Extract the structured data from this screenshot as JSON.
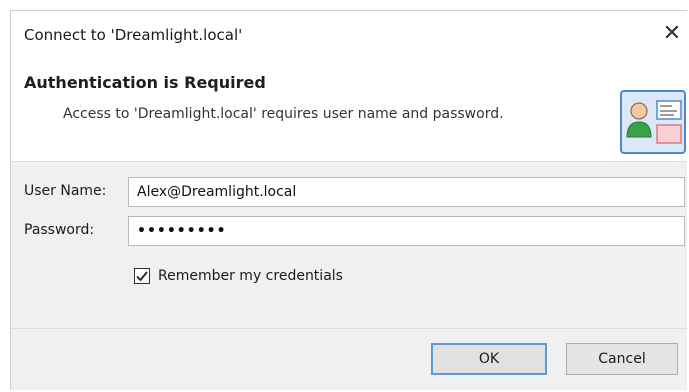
{
  "window": {
    "title": "Connect to 'Dreamlight.local'",
    "close_glyph": "✕"
  },
  "header": {
    "title": "Authentication is Required",
    "subtitle": "Access to 'Dreamlight.local' requires user name and password.",
    "icon": "user-card-icon"
  },
  "form": {
    "username_label": "User Name:",
    "username_value": "Alex@Dreamlight.local",
    "password_label": "Password:",
    "password_value": "•••••••••",
    "remember_label": "Remember my credentials",
    "remember_checked": true
  },
  "buttons": {
    "ok_label": "OK",
    "cancel_label": "Cancel"
  },
  "colors": {
    "accent_border": "#5a9bd5",
    "dialog_bg": "#f0f0f0",
    "header_bg": "#ffffff"
  }
}
